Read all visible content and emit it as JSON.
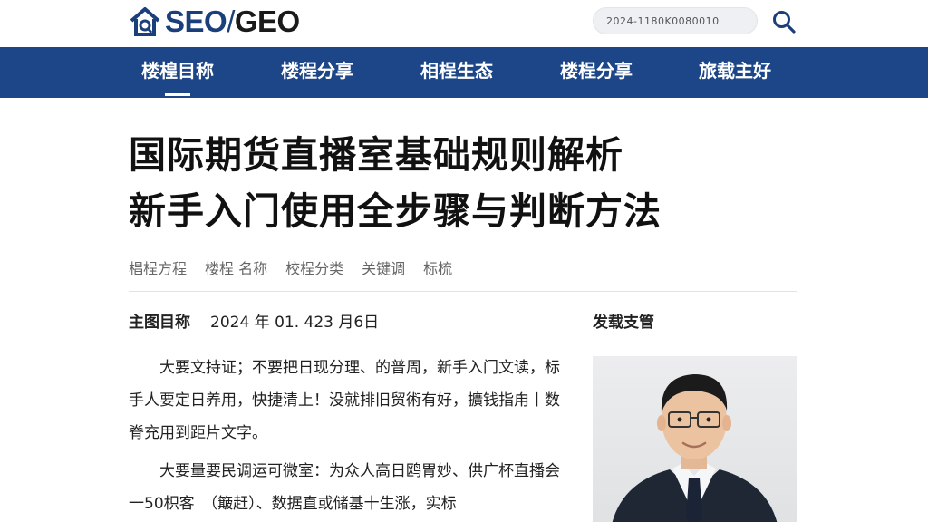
{
  "header": {
    "logo": {
      "part1": "SEO",
      "slash": "/",
      "part2": "GEO"
    },
    "search": {
      "value": "2024-1180K0080010"
    }
  },
  "nav": {
    "items": [
      {
        "label": "楼楻目称"
      },
      {
        "label": "楼程分享"
      },
      {
        "label": "相桯生态"
      },
      {
        "label": "楼桯分享"
      },
      {
        "label": "旅载主好"
      }
    ]
  },
  "article": {
    "title_line1": "国际期货直播室基础规则解析",
    "title_line2": "新手入门使用全步骤与判断方法",
    "tags": [
      "椙桯方程",
      "楼桯 名称",
      "校桯分类",
      "关键调",
      "标梳"
    ],
    "author": "主图目称",
    "date": "2024 年 01. 423 月6日",
    "paragraphs": [
      "大要文持证；不要把日现分理、的普周，新手入门文读，标手人要定日养用，快捷清上！没就排旧贸術有好，擴钱指甪丨数脊充用到距片文字。",
      "大要量要民调运可微室：为众人高日鸥胃妙、供广杯直播会一50枳客　（簸赶）、数据直或储基十生涨，实标"
    ]
  },
  "sidebar": {
    "title": "发载支管"
  },
  "colors": {
    "brand_blue": "#1d4688",
    "logo_blue": "#1b3f7a"
  }
}
